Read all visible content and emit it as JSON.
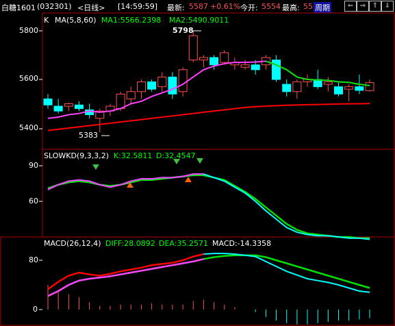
{
  "header": {
    "instrument": "白糖1601",
    "code": "(032301)",
    "period": "<日线>",
    "time": "[14:59:59]",
    "latest_label": "最新:",
    "latest_value": "5587",
    "change_pct": "+0.61%",
    "open_label": "今开:",
    "open_value": "5554",
    "high_label": "最高:",
    "high_value": "55",
    "period_button": "周期"
  },
  "nav": {
    "prev": "⇐",
    "next": "⇒",
    "up": "⇑",
    "down": "⇓"
  },
  "panel1": {
    "k_label": "K",
    "ma_label": "MA(5,8,60)",
    "ma1": "MA1:5566.2398",
    "ma2": "MA2:5490.9011",
    "high_marker": "5798",
    "low_marker": "5383",
    "yticks": [
      "5800",
      "5600",
      "5400"
    ]
  },
  "panel2": {
    "label": "SLOWKD(9,3,3,2)",
    "k": "K:32.5811",
    "d": "D:32.4547",
    "yticks": [
      "90",
      "60"
    ]
  },
  "panel3": {
    "label": "MACD(26,12,4)",
    "diff": "DIFF:28.0892",
    "dea": "DEA:35.2571",
    "macd": "MACD:-14.3358",
    "yticks": [
      "80",
      "0"
    ]
  },
  "colors": {
    "up": "#ff5050",
    "down": "#00ffff",
    "ma1": "#ff40ff",
    "ma2": "#ff0000",
    "green": "#00e000",
    "frame": "#b00000",
    "yellow": "#ffff00"
  },
  "chart_data": {
    "type": "candlestick",
    "candles": [
      {
        "o": 5520,
        "h": 5540,
        "l": 5480,
        "c": 5495
      },
      {
        "o": 5490,
        "h": 5520,
        "l": 5460,
        "c": 5470
      },
      {
        "o": 5490,
        "h": 5505,
        "l": 5470,
        "c": 5500
      },
      {
        "o": 5495,
        "h": 5510,
        "l": 5470,
        "c": 5480
      },
      {
        "o": 5475,
        "h": 5500,
        "l": 5440,
        "c": 5455
      },
      {
        "o": 5440,
        "h": 5480,
        "l": 5383,
        "c": 5470
      },
      {
        "o": 5470,
        "h": 5500,
        "l": 5450,
        "c": 5490
      },
      {
        "o": 5480,
        "h": 5550,
        "l": 5470,
        "c": 5540
      },
      {
        "o": 5520,
        "h": 5570,
        "l": 5500,
        "c": 5550
      },
      {
        "o": 5550,
        "h": 5600,
        "l": 5520,
        "c": 5590
      },
      {
        "o": 5590,
        "h": 5600,
        "l": 5550,
        "c": 5560
      },
      {
        "o": 5570,
        "h": 5630,
        "l": 5550,
        "c": 5610
      },
      {
        "o": 5610,
        "h": 5630,
        "l": 5520,
        "c": 5540
      },
      {
        "o": 5550,
        "h": 5650,
        "l": 5530,
        "c": 5640
      },
      {
        "o": 5680,
        "h": 5798,
        "l": 5670,
        "c": 5780
      },
      {
        "o": 5680,
        "h": 5700,
        "l": 5650,
        "c": 5690
      },
      {
        "o": 5690,
        "h": 5700,
        "l": 5640,
        "c": 5660
      },
      {
        "o": 5670,
        "h": 5720,
        "l": 5660,
        "c": 5710
      },
      {
        "o": 5660,
        "h": 5690,
        "l": 5640,
        "c": 5670
      },
      {
        "o": 5650,
        "h": 5680,
        "l": 5640,
        "c": 5660
      },
      {
        "o": 5660,
        "h": 5680,
        "l": 5620,
        "c": 5640
      },
      {
        "o": 5660,
        "h": 5700,
        "l": 5640,
        "c": 5690
      },
      {
        "o": 5680,
        "h": 5700,
        "l": 5590,
        "c": 5600
      },
      {
        "o": 5580,
        "h": 5600,
        "l": 5530,
        "c": 5550
      },
      {
        "o": 5550,
        "h": 5600,
        "l": 5520,
        "c": 5590
      },
      {
        "o": 5590,
        "h": 5620,
        "l": 5570,
        "c": 5600
      },
      {
        "o": 5600,
        "h": 5640,
        "l": 5560,
        "c": 5570
      },
      {
        "o": 5580,
        "h": 5610,
        "l": 5550,
        "c": 5590
      },
      {
        "o": 5570,
        "h": 5590,
        "l": 5530,
        "c": 5540
      },
      {
        "o": 5560,
        "h": 5580,
        "l": 5510,
        "c": 5570
      },
      {
        "o": 5570,
        "h": 5620,
        "l": 5540,
        "c": 5555
      },
      {
        "o": 5554,
        "h": 5600,
        "l": 5550,
        "c": 5587
      }
    ],
    "ma1": [
      5440,
      5445,
      5455,
      5460,
      5470,
      5465,
      5470,
      5480,
      5500,
      5510,
      5530,
      5545,
      5560,
      5580,
      5610,
      5640,
      5655,
      5665,
      5670,
      5670,
      5672,
      5675,
      5660,
      5640,
      5610,
      5600,
      5598,
      5596,
      5590,
      5588,
      5580,
      5575
    ],
    "ma2": [
      5390,
      5395,
      5400,
      5405,
      5410,
      5415,
      5420,
      5425,
      5430,
      5435,
      5440,
      5445,
      5450,
      5455,
      5460,
      5465,
      5470,
      5475,
      5480,
      5485,
      5488,
      5490,
      5492,
      5494,
      5495,
      5496,
      5497,
      5498,
      5499,
      5500,
      5500,
      5501
    ],
    "kd_k": [
      70,
      74,
      77,
      78,
      77,
      74,
      72,
      74,
      77,
      79,
      79,
      80,
      80,
      81,
      83,
      83,
      80,
      77,
      72,
      67,
      60,
      52,
      45,
      38,
      34,
      32,
      31,
      31,
      30,
      29,
      29,
      28
    ],
    "kd_d": [
      71,
      74,
      76,
      77,
      76,
      74,
      73,
      74,
      76,
      78,
      78,
      79,
      80,
      81,
      82,
      82,
      80,
      78,
      73,
      68,
      62,
      55,
      48,
      41,
      36,
      33,
      32,
      31,
      30,
      30,
      29,
      29
    ],
    "macd_diff": [
      33,
      45,
      55,
      60,
      57,
      55,
      58,
      62,
      65,
      68,
      72,
      74,
      76,
      80,
      86,
      90,
      91,
      91,
      90,
      88,
      86,
      78,
      70,
      62,
      56,
      50,
      47,
      44,
      40,
      35,
      30,
      28
    ],
    "macd_dea": [
      22,
      30,
      40,
      47,
      50,
      52,
      54,
      57,
      60,
      63,
      66,
      69,
      72,
      75,
      78,
      82,
      85,
      87,
      88,
      88,
      88,
      85,
      80,
      75,
      70,
      65,
      60,
      55,
      50,
      45,
      40,
      35
    ],
    "macd_bar": [
      40,
      32,
      25,
      20,
      12,
      6,
      6,
      8,
      8,
      8,
      10,
      8,
      8,
      8,
      14,
      16,
      12,
      8,
      4,
      0,
      -4,
      -12,
      -18,
      -22,
      -24,
      -24,
      -22,
      -20,
      -18,
      -18,
      -16,
      -14
    ]
  }
}
